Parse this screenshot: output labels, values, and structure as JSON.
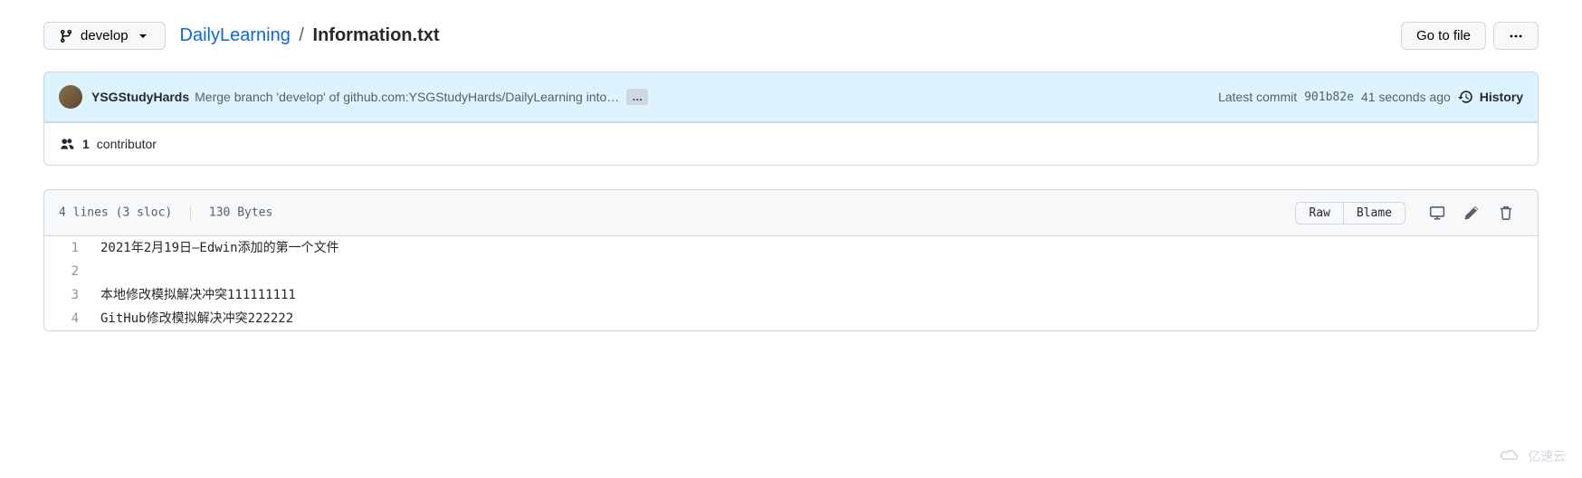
{
  "branch": {
    "label": "develop"
  },
  "breadcrumb": {
    "repo": "DailyLearning",
    "sep": "/",
    "file": "Information.txt"
  },
  "topActions": {
    "goToFile": "Go to file"
  },
  "commit": {
    "author": "YSGStudyHards",
    "message": "Merge branch 'develop' of github.com:YSGStudyHards/DailyLearning into…",
    "latestLabel": "Latest commit",
    "sha": "901b82e",
    "age": "41 seconds ago",
    "historyLabel": "History"
  },
  "contributors": {
    "count": "1",
    "label": "contributor"
  },
  "fileHeader": {
    "lines": "4 lines (3 sloc)",
    "size": "130 Bytes",
    "raw": "Raw",
    "blame": "Blame"
  },
  "code": {
    "l1": {
      "n": "1",
      "t": "2021年2月19日—Edwin添加的第一个文件"
    },
    "l2": {
      "n": "2",
      "t": ""
    },
    "l3": {
      "n": "3",
      "t": "本地修改模拟解决冲突111111111"
    },
    "l4": {
      "n": "4",
      "t": "GitHub修改模拟解决冲突222222"
    }
  },
  "watermark": "亿速云"
}
